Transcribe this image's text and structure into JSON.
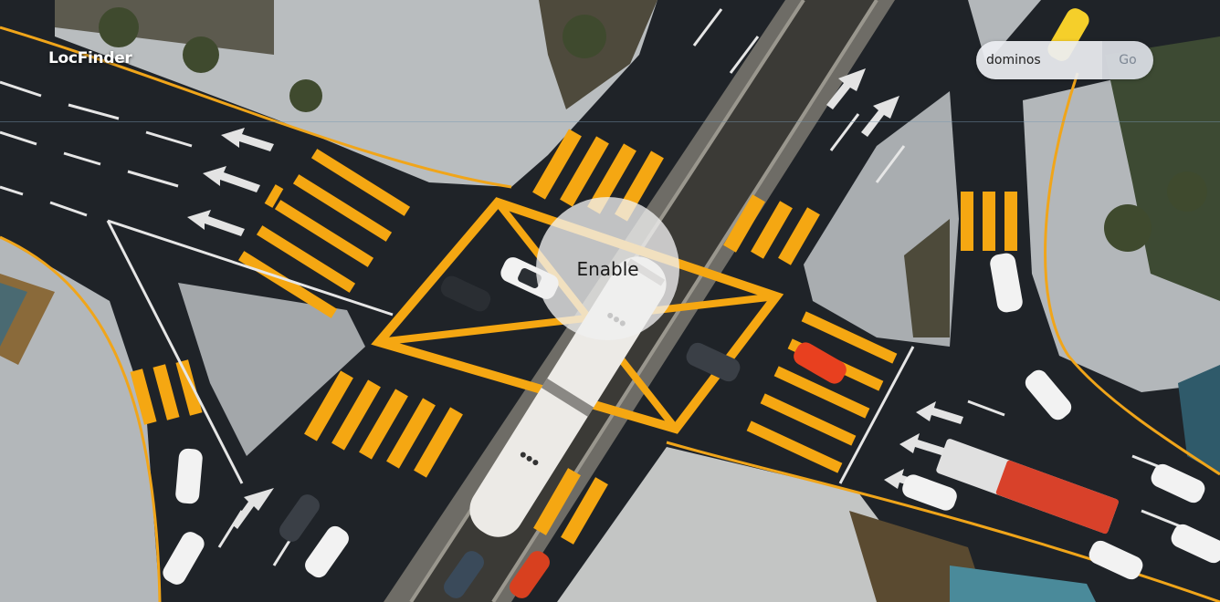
{
  "app": {
    "brand": "LocFinder"
  },
  "search": {
    "value": "dominos",
    "button_label": "Go"
  },
  "main": {
    "enable_label": "Enable"
  },
  "colors": {
    "road": "#1d2126",
    "crosswalk": "#f5a712",
    "sidewalk": "#bfc3c6",
    "lane_marking": "#e8e8e8"
  }
}
